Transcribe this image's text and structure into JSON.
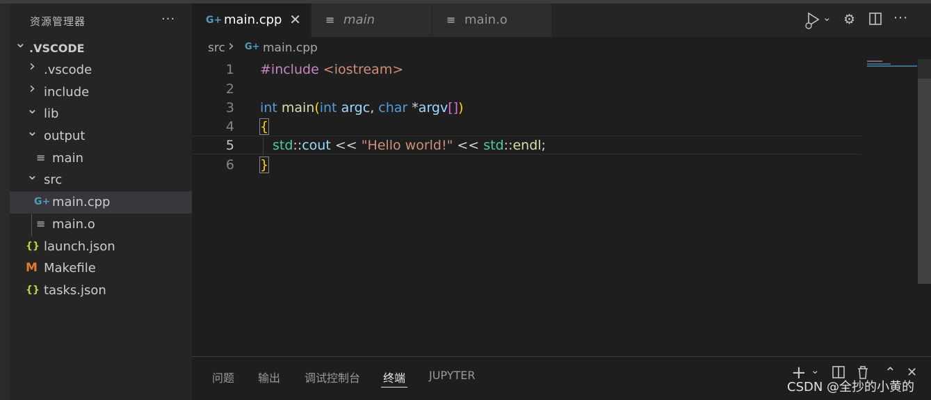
{
  "sidebar": {
    "title": "资源管理器",
    "more": "···",
    "root": ".VSCODE",
    "items": [
      {
        "label": ".vscode",
        "kind": "folder",
        "expanded": false
      },
      {
        "label": "include",
        "kind": "folder",
        "expanded": false
      },
      {
        "label": "lib",
        "kind": "folder",
        "expanded": true
      },
      {
        "label": "output",
        "kind": "folder",
        "expanded": true
      },
      {
        "label": "main",
        "kind": "file",
        "icon": "≡"
      },
      {
        "label": "src",
        "kind": "folder",
        "expanded": true
      },
      {
        "label": "main.cpp",
        "kind": "file",
        "icon": "G+",
        "selected": true
      },
      {
        "label": "main.o",
        "kind": "file",
        "icon": "≡"
      },
      {
        "label": "launch.json",
        "kind": "file",
        "icon": "{}"
      },
      {
        "label": "Makefile",
        "kind": "file",
        "icon": "M"
      },
      {
        "label": "tasks.json",
        "kind": "file",
        "icon": "{}"
      }
    ]
  },
  "tabs": [
    {
      "label": "main.cpp",
      "icon": "G+",
      "active": true,
      "close": "✕"
    },
    {
      "label": "main",
      "icon": "≡",
      "active": false
    },
    {
      "label": "main.o",
      "icon": "≡",
      "active": false
    }
  ],
  "breadcrumb": {
    "folder": "src",
    "separator": "›",
    "icon": "G+",
    "file": "main.cpp"
  },
  "editor": {
    "line_numbers": [
      "1",
      "2",
      "3",
      "4",
      "5",
      "6"
    ],
    "current_line": 5,
    "code": {
      "l1_directive": "#include",
      "l1_header": " <iostream>",
      "l3_int": "int",
      "l3_main": "main",
      "l3_paren_open": "(",
      "l3_int2": "int",
      "l3_argc": "argc",
      "l3_comma": ", ",
      "l3_char": "char",
      "l3_star": " *",
      "l3_argv": "argv",
      "l3_brackets": "[]",
      "l3_paren_close": ")",
      "l4_brace": "{",
      "l5_std1": "std",
      "l5_colons1": "::",
      "l5_cout": "cout",
      "l5_op1": " << ",
      "l5_string": "\"Hello world!\"",
      "l5_op2": " << ",
      "l5_std2": "std",
      "l5_colons2": "::",
      "l5_endl": "endl;",
      "l6_brace": "}"
    }
  },
  "panel": {
    "tabs": [
      "问题",
      "输出",
      "调试控制台",
      "终端",
      "JUPYTER"
    ],
    "active_tab": "终端",
    "actions": {
      "add": "+",
      "dropdown": "⌄",
      "split": "⊟",
      "trash": "🗑",
      "maximize": "⌃",
      "close": "✕"
    }
  },
  "watermark": "CSDN @全抄的小黄的",
  "colors": {
    "sidebar_bg": "#252526",
    "editor_bg": "#1e1e1e",
    "keyword": "#569cd6",
    "function": "#dcdcaa",
    "string": "#ce9178",
    "include": "#c586c0",
    "namespace": "#4ec9b0",
    "cpp_icon": "#519aba",
    "json_icon": "#cbcb41",
    "makefile_icon": "#e37933"
  }
}
